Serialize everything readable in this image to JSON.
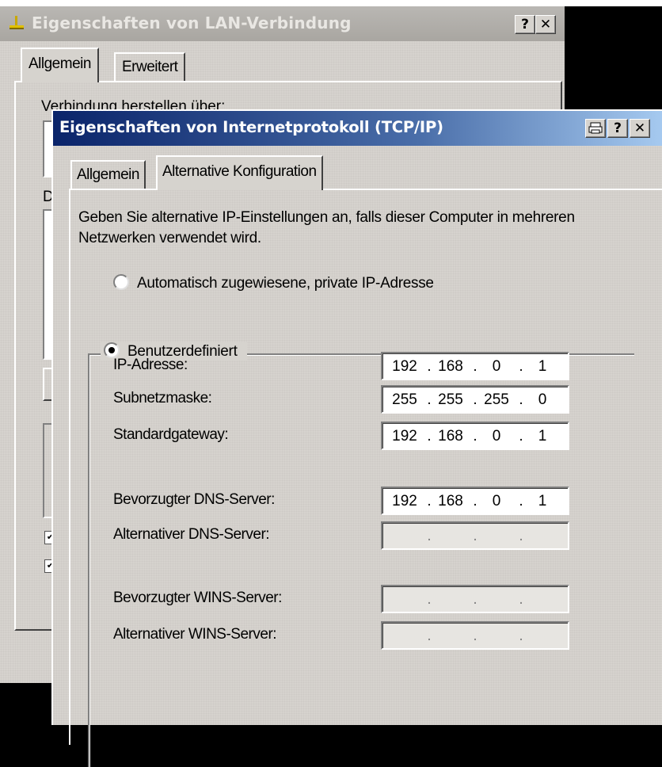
{
  "lan_dialog": {
    "title": "Eigenschaften von LAN-Verbindung",
    "help_button": "?",
    "close_button": "✕",
    "tabs": [
      "Allgemein",
      "Erweitert"
    ],
    "partial_text_1": "Verbindung herstellen über:",
    "partial_text_2": "D"
  },
  "tcp_dialog": {
    "title": "Eigenschaften von Internetprotokoll (TCP/IP)",
    "help_button": "?",
    "close_button": "✕",
    "tabs": [
      "Allgemein",
      "Alternative Konfiguration"
    ],
    "active_tab": "Alternative Konfiguration",
    "description": "Geben Sie alternative IP-Einstellungen an, falls dieser Computer in mehreren Netzwerken verwendet wird.",
    "radio_auto": "Automatisch zugewiesene, private IP-Adresse",
    "radio_custom": "Benutzerdefiniert",
    "selected_option": "Benutzerdefiniert",
    "fields": [
      {
        "label": "IP-Adresse:",
        "octets": [
          "192",
          "168",
          "0",
          "1"
        ]
      },
      {
        "label": "Subnetzmaske:",
        "octets": [
          "255",
          "255",
          "255",
          "0"
        ]
      },
      {
        "label": "Standardgateway:",
        "octets": [
          "192",
          "168",
          "0",
          "1"
        ]
      },
      {
        "label": "Bevorzugter DNS-Server:",
        "octets": [
          "192",
          "168",
          "0",
          "1"
        ]
      },
      {
        "label": "Alternativer DNS-Server:",
        "octets": [
          "",
          "",
          "",
          ""
        ]
      },
      {
        "label": "Bevorzugter WINS-Server:",
        "octets": [
          "",
          "",
          "",
          ""
        ]
      },
      {
        "label": "Alternativer WINS-Server:",
        "octets": [
          "",
          "",
          "",
          ""
        ]
      }
    ]
  },
  "colors": {
    "dialog_face": "#d6d3ce",
    "active_title_start": "#0a246a",
    "active_title_end": "#a6caf0",
    "inactive_title": "#a9a6a1"
  }
}
